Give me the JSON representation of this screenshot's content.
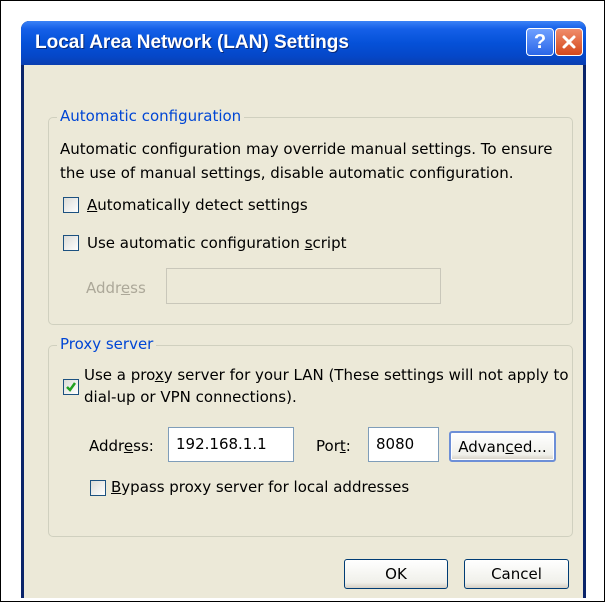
{
  "window": {
    "title": "Local Area Network (LAN) Settings",
    "help_glyph": "?",
    "close_icon": "close-icon"
  },
  "auto_config": {
    "legend": "Automatic configuration",
    "description": "Automatic configuration may override manual settings.  To ensure the use of manual settings, disable automatic configuration.",
    "detect": {
      "pre": "",
      "accel": "A",
      "post": "utomatically detect settings",
      "checked": false
    },
    "script": {
      "pre": "Use automatic configuration ",
      "accel": "s",
      "post": "cript",
      "checked": false
    },
    "address": {
      "pre": "Addr",
      "accel": "e",
      "post": "ss",
      "value": "",
      "enabled": false
    }
  },
  "proxy": {
    "legend": "Proxy server",
    "use_proxy": {
      "line1_pre": "Use a pro",
      "line1_accel": "x",
      "line1_post": "y server for your LAN (These settings will not apply to",
      "line2": "dial-up or VPN connections).",
      "checked": true
    },
    "address": {
      "pre": "Addr",
      "accel": "e",
      "post": "ss:",
      "value": "192.168.1.1"
    },
    "port": {
      "pre": "Por",
      "accel": "t",
      "post": ":",
      "value": "8080"
    },
    "advanced": {
      "pre": "Advan",
      "accel": "c",
      "post": "ed..."
    },
    "bypass": {
      "pre": "",
      "accel": "B",
      "post": "ypass proxy server for local addresses",
      "checked": false
    }
  },
  "buttons": {
    "ok": "OK",
    "cancel": "Cancel"
  },
  "colors": {
    "legend": "#0046d5",
    "check": "#21a121",
    "client_bg": "#ece9d8"
  }
}
